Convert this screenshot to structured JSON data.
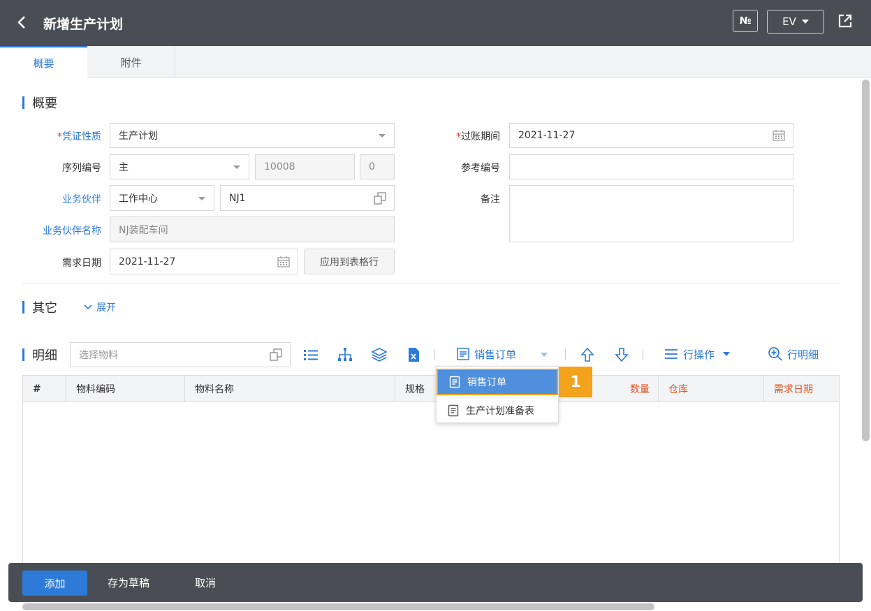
{
  "header": {
    "title": "新增生产计划",
    "no_label": "№",
    "lang_label": "EV"
  },
  "tabs": [
    {
      "label": "概要"
    },
    {
      "label": "附件"
    }
  ],
  "overview": {
    "section_title": "概要",
    "voucher_type": {
      "label": "凭证性质",
      "value": "生产计划"
    },
    "series": {
      "label": "序列编号",
      "value": "主",
      "number": "10008",
      "suffix": "0"
    },
    "partner": {
      "label": "业务伙伴",
      "type": "工作中心",
      "code": "NJ1"
    },
    "partner_name": {
      "label": "业务伙伴名称",
      "value": "NJ装配车间"
    },
    "required_date": {
      "label": "需求日期",
      "value": "2021-11-27",
      "apply_label": "应用到表格行"
    },
    "posting_date": {
      "label": "过账期间",
      "value": "2021-11-27"
    },
    "reference": {
      "label": "参考编号",
      "value": ""
    },
    "remark": {
      "label": "备注",
      "value": ""
    }
  },
  "others": {
    "section_title": "其它",
    "expand_label": "展开"
  },
  "detail": {
    "section_title": "明细",
    "material_placeholder": "选择物料",
    "sales_order_label": "销售订单",
    "row_ops_label": "行操作",
    "row_detail_label": "行明细",
    "columns": [
      "#",
      "物料编码",
      "物料名称",
      "规格",
      "数量",
      "仓库",
      "需求日期"
    ]
  },
  "dropdown": {
    "items": [
      "销售订单",
      "生产计划准备表"
    ],
    "step": "1"
  },
  "footer": {
    "add_label": "添加",
    "draft_label": "存为草稿",
    "cancel_label": "取消"
  },
  "colors": {
    "header_bg": "#4a4d53",
    "accent": "#2d7ad8",
    "required": "#e0322b",
    "highlight": "#f3a21b"
  }
}
